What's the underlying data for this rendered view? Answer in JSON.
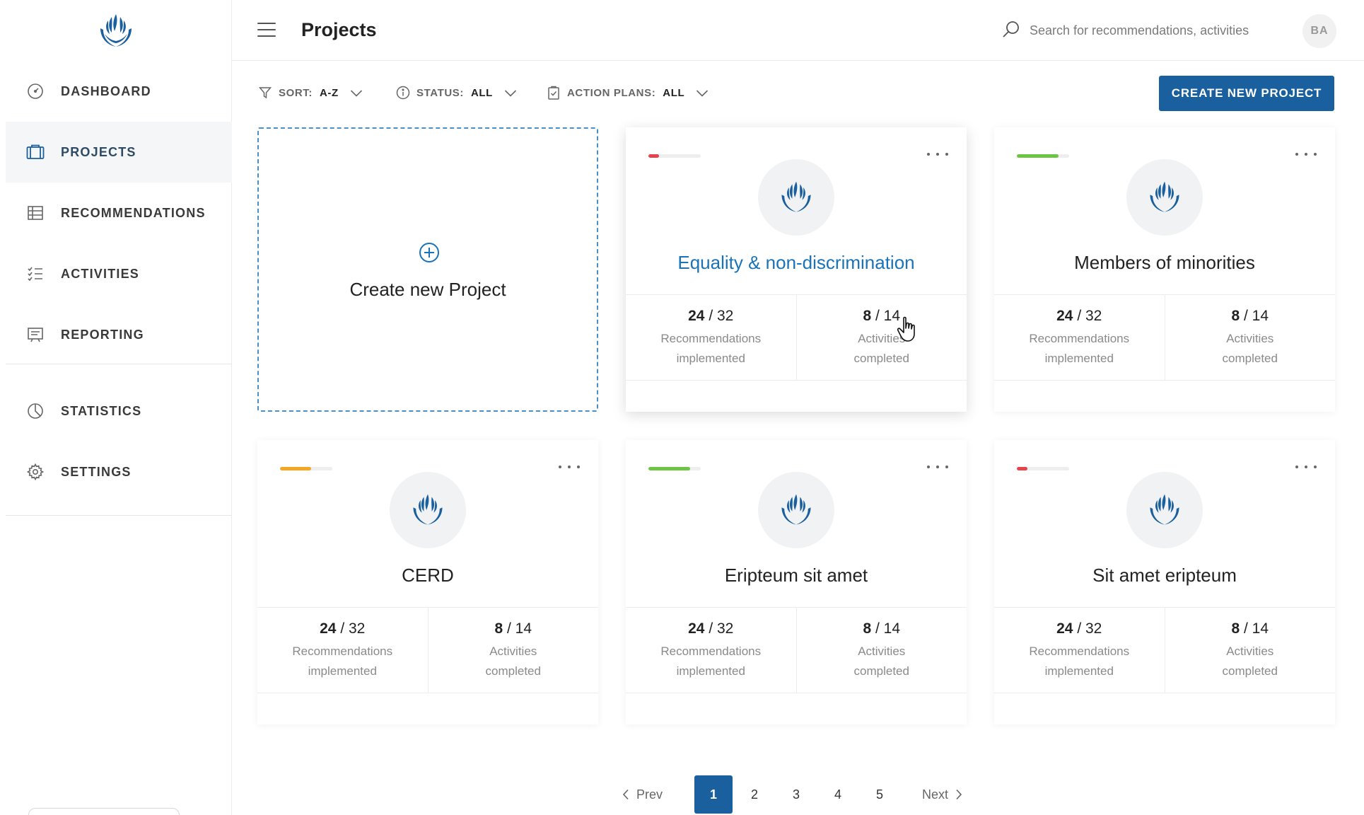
{
  "sidebar": {
    "logo": "un-human-rights-emblem",
    "items": [
      {
        "label": "DASHBOARD",
        "icon": "dashboard-gauge-icon"
      },
      {
        "label": "PROJECTS",
        "icon": "briefcase-icon",
        "active": true
      },
      {
        "label": "RECOMMENDATIONS",
        "icon": "table-icon"
      },
      {
        "label": "ACTIVITIES",
        "icon": "checklist-icon"
      },
      {
        "label": "REPORTING",
        "icon": "report-icon"
      },
      {
        "label": "STATISTICS",
        "icon": "pie-chart-icon"
      },
      {
        "label": "SETTINGS",
        "icon": "gear-icon"
      }
    ]
  },
  "header": {
    "title": "Projects",
    "search_placeholder": "Search for recommendations, activities",
    "avatar_initials": "BA"
  },
  "filters": {
    "sort": {
      "label": "SORT:",
      "value": "A-Z"
    },
    "status": {
      "label": "STATUS:",
      "value": "ALL"
    },
    "action_plans": {
      "label": "ACTION PLANS:",
      "value": "ALL"
    }
  },
  "create_button": "CREATE NEW PROJECT",
  "create_card_label": "Create new Project",
  "colors": {
    "accent": "#1a5f9e",
    "red": "#e8424a",
    "green": "#6cc644",
    "orange": "#f5a623"
  },
  "projects": [
    {
      "name": "Equality & non-discrimination",
      "progress_color": "#e8424a",
      "progress": 0.2,
      "rec_done": "24",
      "rec_total": "/ 32",
      "rec_caption_1": "Recommendations",
      "rec_caption_2": "implemented",
      "act_done": "8",
      "act_total": "/ 14",
      "act_caption_1": "Activities",
      "act_caption_2": "completed"
    },
    {
      "name": "Members of minorities",
      "progress_color": "#6cc644",
      "progress": 0.8,
      "rec_done": "24",
      "rec_total": "/ 32",
      "rec_caption_1": "Recommendations",
      "rec_caption_2": "implemented",
      "act_done": "8",
      "act_total": "/ 14",
      "act_caption_1": "Activities",
      "act_caption_2": "completed"
    },
    {
      "name": "CERD",
      "progress_color": "#f5a623",
      "progress": 0.6,
      "rec_done": "24",
      "rec_total": "/ 32",
      "rec_caption_1": "Recommendations",
      "rec_caption_2": "implemented",
      "act_done": "8",
      "act_total": "/ 14",
      "act_caption_1": "Activities",
      "act_caption_2": "completed"
    },
    {
      "name": "Eripteum sit amet",
      "progress_color": "#6cc644",
      "progress": 0.8,
      "rec_done": "24",
      "rec_total": "/ 32",
      "rec_caption_1": "Recommendations",
      "rec_caption_2": "implemented",
      "act_done": "8",
      "act_total": "/ 14",
      "act_caption_1": "Activities",
      "act_caption_2": "completed"
    },
    {
      "name": "Sit amet eripteum",
      "progress_color": "#e8424a",
      "progress": 0.2,
      "rec_done": "24",
      "rec_total": "/ 32",
      "rec_caption_1": "Recommendations",
      "rec_caption_2": "implemented",
      "act_done": "8",
      "act_total": "/ 14",
      "act_caption_1": "Activities",
      "act_caption_2": "completed"
    }
  ],
  "pagination": {
    "prev": "Prev",
    "next": "Next",
    "pages": [
      "1",
      "2",
      "3",
      "4",
      "5"
    ],
    "current": "1"
  }
}
